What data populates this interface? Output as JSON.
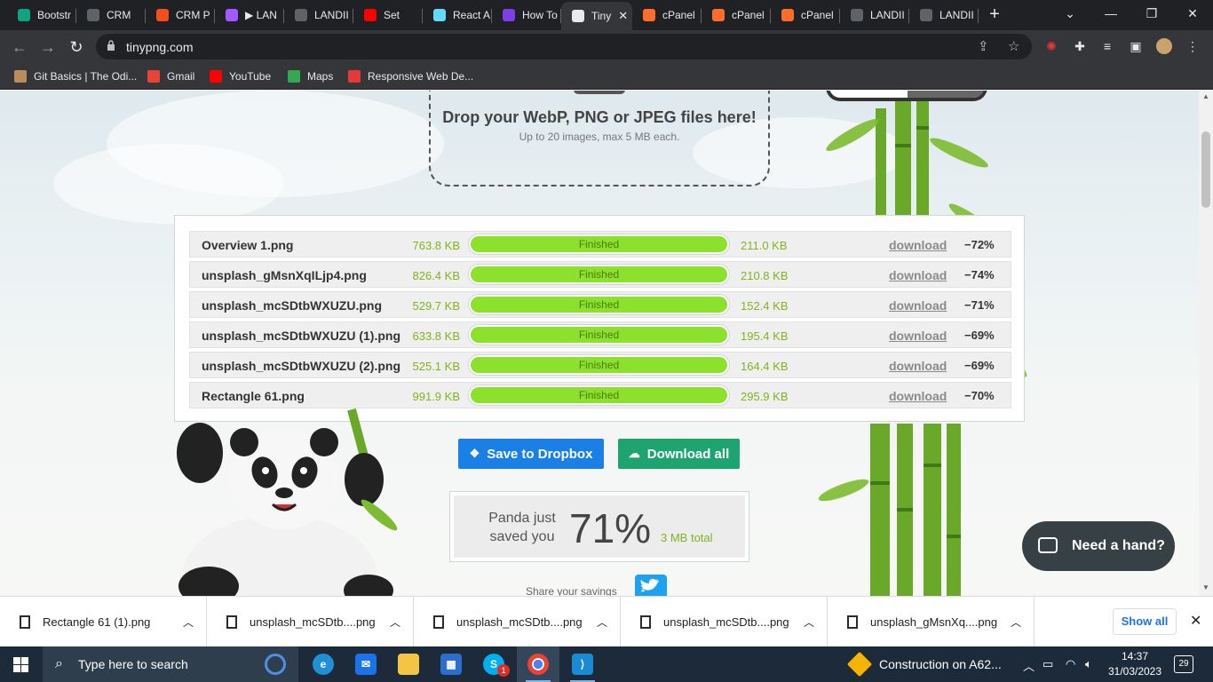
{
  "tabs": [
    {
      "title": "Bootstr",
      "color": "#10a37f",
      "glyph": "◎"
    },
    {
      "title": "CRM",
      "color": "#5f6368",
      "glyph": "◍"
    },
    {
      "title": "CRM P",
      "color": "#f24e1e",
      "glyph": "F"
    },
    {
      "title": "▶ LAN",
      "color": "#a259ff",
      "glyph": "F"
    },
    {
      "title": "LANDII",
      "color": "#5f6368",
      "glyph": "◍"
    },
    {
      "title": "Set",
      "color": "#ff0000",
      "glyph": "▶"
    },
    {
      "title": "React A",
      "color": "#61dafb",
      "glyph": "⚛"
    },
    {
      "title": "How To",
      "color": "#7b3fe4",
      "glyph": "K"
    },
    {
      "title": "Tiny",
      "color": "#e8eaed",
      "glyph": "🐼"
    },
    {
      "title": "cPanel",
      "color": "#ff6c2c",
      "glyph": "cP"
    },
    {
      "title": "cPanel",
      "color": "#ff6c2c",
      "glyph": "cP"
    },
    {
      "title": "cPanel",
      "color": "#ff6c2c",
      "glyph": "cP"
    },
    {
      "title": "LANDII",
      "color": "#5f6368",
      "glyph": "◍"
    },
    {
      "title": "LANDII",
      "color": "#5f6368",
      "glyph": "◍"
    }
  ],
  "address": {
    "url": "tinypng.com"
  },
  "bookmarks": [
    {
      "label": "Git Basics | The Odi...",
      "color": "#b98c5a",
      "glyph": "♞"
    },
    {
      "label": "Gmail",
      "color": "#ea4335",
      "glyph": "M"
    },
    {
      "label": "YouTube",
      "color": "#ff0000",
      "glyph": "▶"
    },
    {
      "label": "Maps",
      "color": "#34a853",
      "glyph": "●"
    },
    {
      "label": "Responsive Web De...",
      "color": "#e53935",
      "glyph": "S"
    }
  ],
  "dropzone": {
    "title": "Drop your WebP, PNG or JPEG files here!",
    "subtitle": "Up to 20 images, max 5 MB each."
  },
  "files": [
    {
      "name": "Overview 1.png",
      "original": "763.8 KB",
      "status": "Finished",
      "progress": 1.0,
      "compressed": "211.0 KB",
      "action": "download",
      "saving": "−72%"
    },
    {
      "name": "unsplash_gMsnXqILjp4.png",
      "original": "826.4 KB",
      "status": "Finished",
      "progress": 1.0,
      "compressed": "210.8 KB",
      "action": "download",
      "saving": "−74%"
    },
    {
      "name": "unsplash_mcSDtbWXUZU.png",
      "original": "529.7 KB",
      "status": "Finished",
      "progress": 1.0,
      "compressed": "152.4 KB",
      "action": "download",
      "saving": "−71%"
    },
    {
      "name": "unsplash_mcSDtbWXUZU (1).png",
      "original": "633.8 KB",
      "status": "Finished",
      "progress": 1.0,
      "compressed": "195.4 KB",
      "action": "download",
      "saving": "−69%"
    },
    {
      "name": "unsplash_mcSDtbWXUZU (2).png",
      "original": "525.1 KB",
      "status": "Finished",
      "progress": 1.0,
      "compressed": "164.4 KB",
      "action": "download",
      "saving": "−69%"
    },
    {
      "name": "Rectangle 61.png",
      "original": "991.9 KB",
      "status": "Finished",
      "progress": 1.0,
      "compressed": "295.9 KB",
      "action": "download",
      "saving": "−70%"
    }
  ],
  "actions": {
    "dropbox": "Save to Dropbox",
    "download_all": "Download all"
  },
  "savings": {
    "label": "Panda just saved you",
    "percent": "71%",
    "total": "3 MB total"
  },
  "share": {
    "label": "Share your savings"
  },
  "help": {
    "label": "Need a hand?"
  },
  "downloads": [
    {
      "name": "Rectangle 61 (1).png"
    },
    {
      "name": "unsplash_mcSDtb....png"
    },
    {
      "name": "unsplash_mcSDtb....png"
    },
    {
      "name": "unsplash_mcSDtb....png"
    },
    {
      "name": "unsplash_gMsnXq....png"
    }
  ],
  "downloads_showall": "Show all",
  "taskbar": {
    "search_placeholder": "Type here to search",
    "notification": "Construction on A62...",
    "time": "14:37",
    "date": "31/03/2023",
    "notif_count": "29",
    "skype_badge": "1"
  },
  "colors": {
    "accent_green": "#8be12b",
    "dropbox_blue": "#1a80e6",
    "download_green": "#1ea46e",
    "twitter": "#1da1f2"
  }
}
